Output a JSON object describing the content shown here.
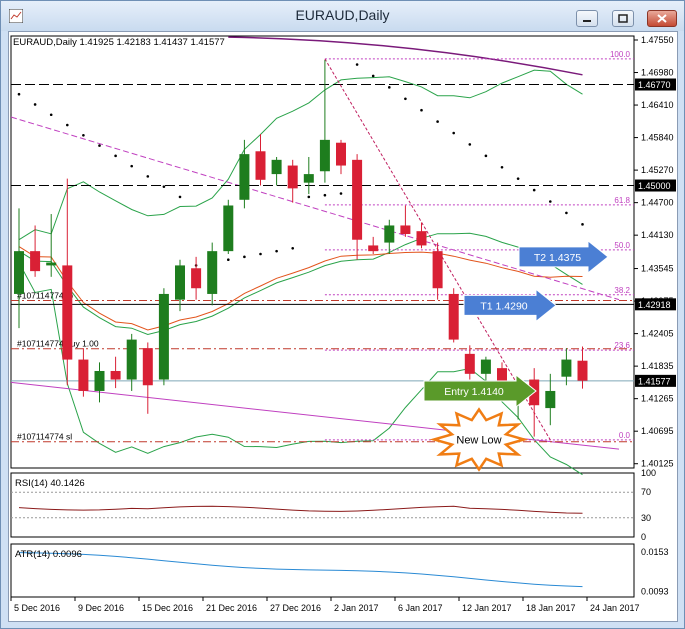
{
  "window": {
    "title": "EURAUD,Daily"
  },
  "main": {
    "header": "EURAUD,Daily  1.41925 1.42183 1.41437 1.41577",
    "price_ticks": [
      "1.47550",
      "1.46980",
      "1.46410",
      "1.45840",
      "1.45270",
      "1.44700",
      "1.44130",
      "1.43545",
      "1.42975",
      "1.42405",
      "1.41835",
      "1.41265",
      "1.40695",
      "1.40125"
    ],
    "price_labels": [
      {
        "text": "1.46770",
        "price": 1.4677,
        "bg": "#000000",
        "fg": "#ffffff"
      },
      {
        "text": "1.45000",
        "price": 1.45,
        "bg": "#000000",
        "fg": "#ffffff"
      },
      {
        "text": "1.42918",
        "price": 1.42918,
        "bg": "#000000",
        "fg": "#ffffff"
      },
      {
        "text": "1.41577",
        "price": 1.41577,
        "bg": "#000000",
        "fg": "#ffffff"
      }
    ],
    "fib_labels": [
      {
        "text": "100.0",
        "price": 1.4722
      },
      {
        "text": "61.8",
        "price": 1.4466
      },
      {
        "text": "50.0",
        "price": 1.43872
      },
      {
        "text": "38.2",
        "price": 1.43085
      },
      {
        "text": "23.6",
        "price": 1.42115
      },
      {
        "text": "0.0",
        "price": 1.40542
      }
    ],
    "order_labels": [
      {
        "text": "#107114774 tp",
        "price": 1.42985
      },
      {
        "text": "#107114774 buy 1.00",
        "price": 1.4214
      },
      {
        "text": "#107114774 sl",
        "price": 1.4051
      }
    ],
    "callouts": [
      {
        "name": "t2-callout",
        "text": "T2 1.4375",
        "color": "#4b7fd4"
      },
      {
        "name": "t1-callout",
        "text": "T1 1.4290",
        "color": "#4b7fd4"
      },
      {
        "name": "entry-callout",
        "text": "Entry  1.4140",
        "color": "#5a9a2a"
      }
    ],
    "new_low": "New Low"
  },
  "rsi": {
    "header": "RSI(14) 40.1426",
    "ticks": [
      "100",
      "70",
      "30",
      "0"
    ]
  },
  "atr": {
    "header": "ATR(14) 0.0096",
    "ticks": [
      "0.0153",
      "0.0093"
    ]
  },
  "time_axis": [
    "5 Dec 2016",
    "9 Dec 2016",
    "15 Dec 2016",
    "21 Dec 2016",
    "27 Dec 2016",
    "2 Jan 2017",
    "6 Jan 2017",
    "12 Jan 2017",
    "18 Jan 2017",
    "24 Jan 2017"
  ],
  "colors": {
    "bull": "#1e7d1e",
    "bear": "#d92035",
    "bollinger": "#2aa34a",
    "ma_slow": "#e2541c",
    "ma_long": "#7a1a7a",
    "parabolic_sar": "#000000",
    "fib": "#c040c0",
    "rsi": "#8b1a1a",
    "atr": "#2a8ad4"
  },
  "chart_data": {
    "type": "candlestick",
    "symbol": "EURAUD",
    "timeframe": "Daily",
    "ylim": [
      1.4005,
      1.4762
    ],
    "candles": [
      {
        "o": 1.431,
        "h": 1.446,
        "l": 1.425,
        "c": 1.4385
      },
      {
        "o": 1.4385,
        "h": 1.443,
        "l": 1.434,
        "c": 1.435
      },
      {
        "o": 1.436,
        "h": 1.445,
        "l": 1.434,
        "c": 1.4365
      },
      {
        "o": 1.436,
        "h": 1.4512,
        "l": 1.415,
        "c": 1.4195
      },
      {
        "o": 1.4195,
        "h": 1.4215,
        "l": 1.413,
        "c": 1.414
      },
      {
        "o": 1.414,
        "h": 1.419,
        "l": 1.412,
        "c": 1.4175
      },
      {
        "o": 1.4175,
        "h": 1.42,
        "l": 1.4145,
        "c": 1.416
      },
      {
        "o": 1.416,
        "h": 1.424,
        "l": 1.414,
        "c": 1.423
      },
      {
        "o": 1.4215,
        "h": 1.4225,
        "l": 1.41,
        "c": 1.415
      },
      {
        "o": 1.416,
        "h": 1.432,
        "l": 1.415,
        "c": 1.431
      },
      {
        "o": 1.43,
        "h": 1.437,
        "l": 1.428,
        "c": 1.436
      },
      {
        "o": 1.4355,
        "h": 1.4375,
        "l": 1.43,
        "c": 1.432
      },
      {
        "o": 1.431,
        "h": 1.44,
        "l": 1.429,
        "c": 1.4385
      },
      {
        "o": 1.4385,
        "h": 1.4475,
        "l": 1.438,
        "c": 1.4465
      },
      {
        "o": 1.4475,
        "h": 1.458,
        "l": 1.446,
        "c": 1.4555
      },
      {
        "o": 1.456,
        "h": 1.459,
        "l": 1.45,
        "c": 1.451
      },
      {
        "o": 1.452,
        "h": 1.455,
        "l": 1.45,
        "c": 1.4545
      },
      {
        "o": 1.4535,
        "h": 1.4545,
        "l": 1.447,
        "c": 1.4495
      },
      {
        "o": 1.4505,
        "h": 1.455,
        "l": 1.4485,
        "c": 1.452
      },
      {
        "o": 1.4525,
        "h": 1.472,
        "l": 1.4505,
        "c": 1.458
      },
      {
        "o": 1.4575,
        "h": 1.458,
        "l": 1.452,
        "c": 1.4535
      },
      {
        "o": 1.4545,
        "h": 1.4555,
        "l": 1.437,
        "c": 1.4405
      },
      {
        "o": 1.4395,
        "h": 1.441,
        "l": 1.438,
        "c": 1.4385
      },
      {
        "o": 1.44,
        "h": 1.444,
        "l": 1.438,
        "c": 1.443
      },
      {
        "o": 1.443,
        "h": 1.4465,
        "l": 1.441,
        "c": 1.4415
      },
      {
        "o": 1.442,
        "h": 1.4435,
        "l": 1.439,
        "c": 1.4395
      },
      {
        "o": 1.4385,
        "h": 1.44,
        "l": 1.43,
        "c": 1.432
      },
      {
        "o": 1.431,
        "h": 1.432,
        "l": 1.4225,
        "c": 1.423
      },
      {
        "o": 1.4205,
        "h": 1.422,
        "l": 1.416,
        "c": 1.417
      },
      {
        "o": 1.417,
        "h": 1.42,
        "l": 1.414,
        "c": 1.4195
      },
      {
        "o": 1.418,
        "h": 1.419,
        "l": 1.413,
        "c": 1.415
      },
      {
        "o": 1.415,
        "h": 1.416,
        "l": 1.409,
        "c": 1.4155
      },
      {
        "o": 1.416,
        "h": 1.418,
        "l": 1.406,
        "c": 1.4115
      },
      {
        "o": 1.411,
        "h": 1.417,
        "l": 1.408,
        "c": 1.414
      },
      {
        "o": 1.4165,
        "h": 1.4215,
        "l": 1.415,
        "c": 1.4195
      },
      {
        "o": 1.4193,
        "h": 1.4218,
        "l": 1.4144,
        "c": 1.4158
      }
    ],
    "horizontal_levels": [
      1.4677,
      1.45,
      1.42918
    ],
    "fibonacci": {
      "high": 1.4722,
      "low": 1.40542
    },
    "orders": {
      "tp": 1.42985,
      "entry": 1.4214,
      "sl": 1.4051
    },
    "targets": {
      "T2": 1.4375,
      "T1": 1.429,
      "Entry": 1.414
    },
    "indicators": [
      "Bollinger Bands",
      "Moving Average",
      "Parabolic SAR",
      "RSI(14)",
      "ATR(14)"
    ],
    "rsi_value": 40.1426,
    "atr_value": 0.0096
  }
}
